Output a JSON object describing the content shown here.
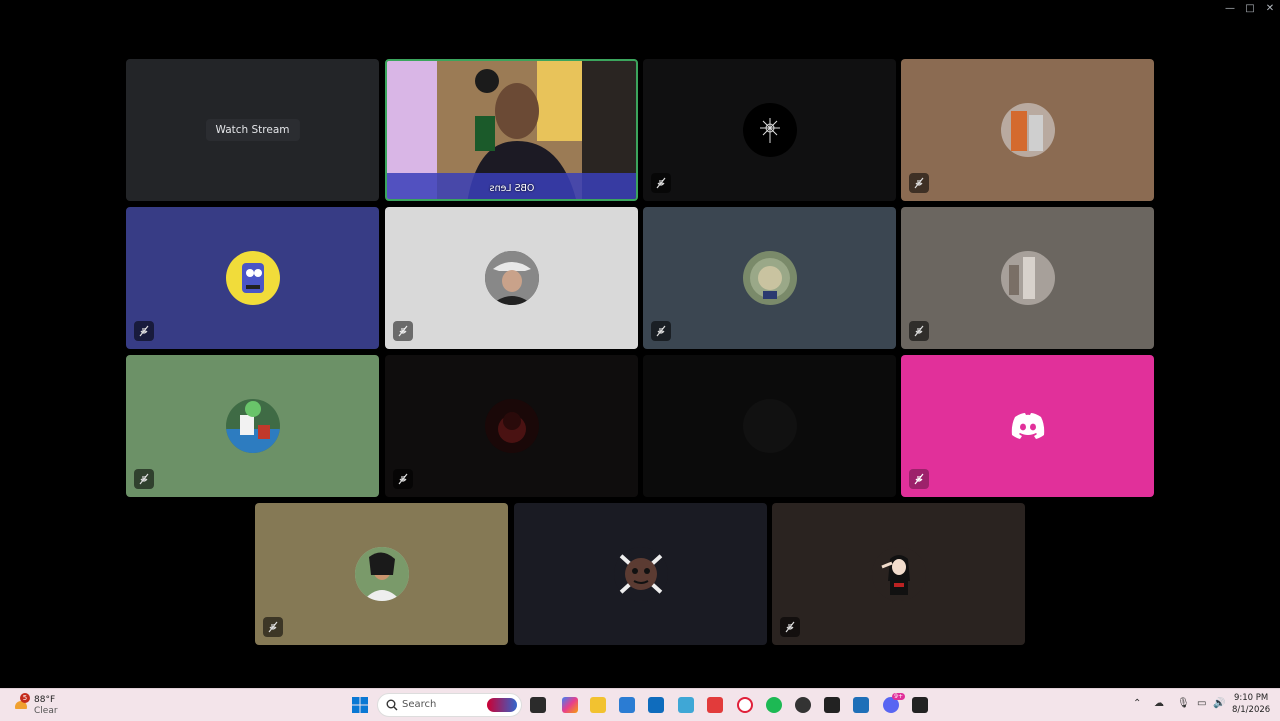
{
  "window": {
    "minimize_glyph": "—",
    "maximize_glyph": "□",
    "close_glyph": "✕"
  },
  "tiles": [
    {
      "id": "stream",
      "bg": "#232528",
      "watch_label": "Watch Stream"
    },
    {
      "id": "video",
      "bg": "#6b5840",
      "video_label": "OBS Lens"
    },
    {
      "id": "p3",
      "bg": "#101011",
      "avatar_bg": "#000000"
    },
    {
      "id": "p4",
      "bg": "#8b6b52",
      "avatar_bg": "#b9aaa0"
    },
    {
      "id": "p5",
      "bg": "#373c85",
      "avatar_bg": "#f1dc3a"
    },
    {
      "id": "p6",
      "bg": "#d9d9d9",
      "avatar_bg": "#555555"
    },
    {
      "id": "p7",
      "bg": "#3b4651",
      "avatar_bg": "#7a8a6a"
    },
    {
      "id": "p8",
      "bg": "#6b6660",
      "avatar_bg": "#a7a09a"
    },
    {
      "id": "p9",
      "bg": "#6c9167",
      "avatar_bg": "#3f6b45"
    },
    {
      "id": "p10",
      "bg": "#0f0d0d",
      "avatar_bg": "#3a1010"
    },
    {
      "id": "p11",
      "bg": "#0b0b0b",
      "avatar_bg": "#111111"
    },
    {
      "id": "p12",
      "bg": "#e1309a",
      "avatar_bg": "#e1309a"
    },
    {
      "id": "p13",
      "bg": "#857955",
      "avatar_bg": "#c9c3b5"
    },
    {
      "id": "p14",
      "bg": "#1a1b23",
      "avatar_bg": "#5b3b32"
    },
    {
      "id": "p15",
      "bg": "#2a2320",
      "avatar_bg": "#2a2320"
    }
  ],
  "taskbar": {
    "weather_temp": "88°F",
    "weather_desc": "Clear",
    "weather_badge": "5",
    "search_placeholder": "Search",
    "time": "9:10 PM",
    "date": "8/1/2026",
    "discord_badge": "9+"
  }
}
